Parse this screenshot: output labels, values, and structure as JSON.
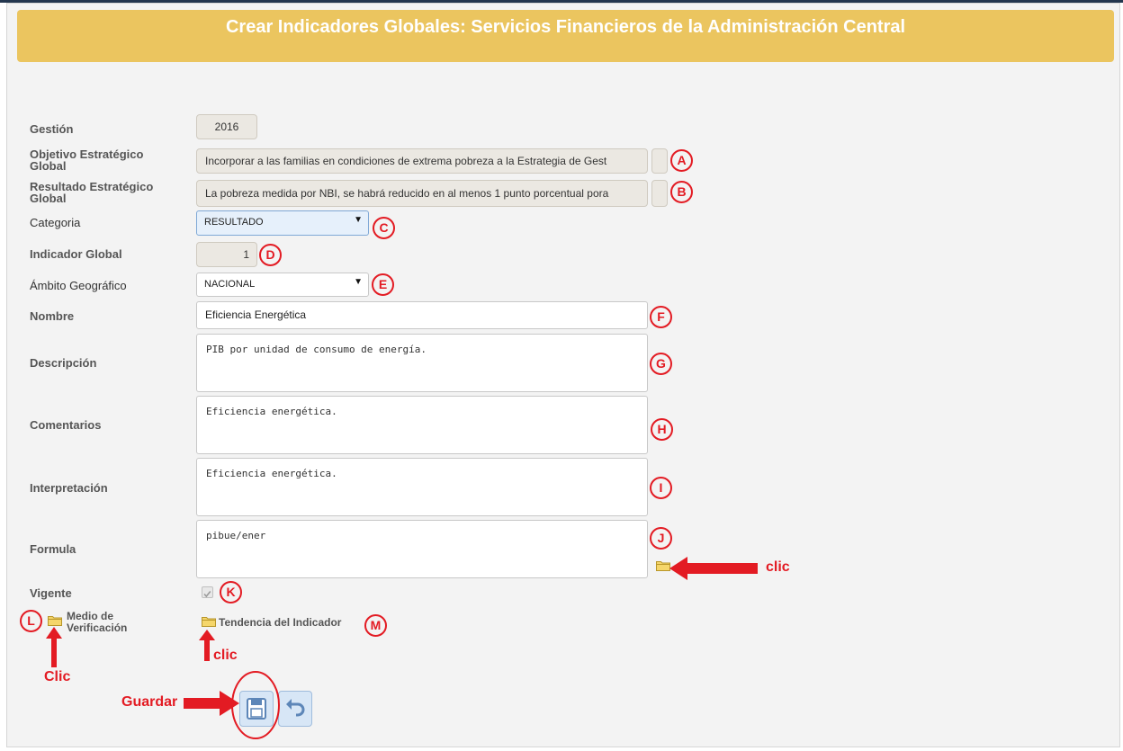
{
  "header": {
    "title": "Crear Indicadores Globales: Servicios Financieros de la Administración Central"
  },
  "fields": {
    "gestion": {
      "label": "Gestión",
      "value": "2016"
    },
    "objetivo": {
      "label": "Objetivo Estratégico Global",
      "value": "Incorporar a las familias en condiciones de extrema pobreza a la Estrategia de Gest"
    },
    "resultado": {
      "label": "Resultado Estratégico Global",
      "value": "La pobreza medida por NBI, se habrá reducido en al menos 1 punto porcentual pora"
    },
    "categoria": {
      "label": "Categoria",
      "value": "RESULTADO"
    },
    "indicador": {
      "label": "Indicador Global",
      "value": "1"
    },
    "ambito": {
      "label": "Ámbito Geográfico",
      "value": "NACIONAL"
    },
    "nombre": {
      "label": "Nombre",
      "value": "Eficiencia Energética"
    },
    "descripcion": {
      "label": "Descripción",
      "value": "PIB por unidad de consumo de energía."
    },
    "comentarios": {
      "label": "Comentarios",
      "value": "Eficiencia energética."
    },
    "interpretacion": {
      "label": "Interpretación",
      "value": "Eficiencia energética."
    },
    "formula": {
      "label": "Formula",
      "value": "pibue/ener"
    },
    "vigente": {
      "label": "Vigente",
      "checked": true
    },
    "medio": {
      "label_line1": "Medio de",
      "label_line2": "Verificación"
    },
    "tendencia": {
      "label": "Tendencia del Indicador"
    }
  },
  "annotations": {
    "markers": [
      "A",
      "B",
      "C",
      "D",
      "E",
      "F",
      "G",
      "H",
      "I",
      "J",
      "K",
      "L",
      "M"
    ],
    "clic_formula": "clic",
    "clic_tendencia": "clic",
    "clic_medio": "Clic",
    "guardar": "Guardar"
  },
  "icons": {
    "caret": "▼",
    "save": "floppy-disk-icon",
    "undo": "undo-icon",
    "folder": "folder-icon"
  },
  "colors": {
    "header": "#ebc55f",
    "annotation": "#e31b23"
  }
}
